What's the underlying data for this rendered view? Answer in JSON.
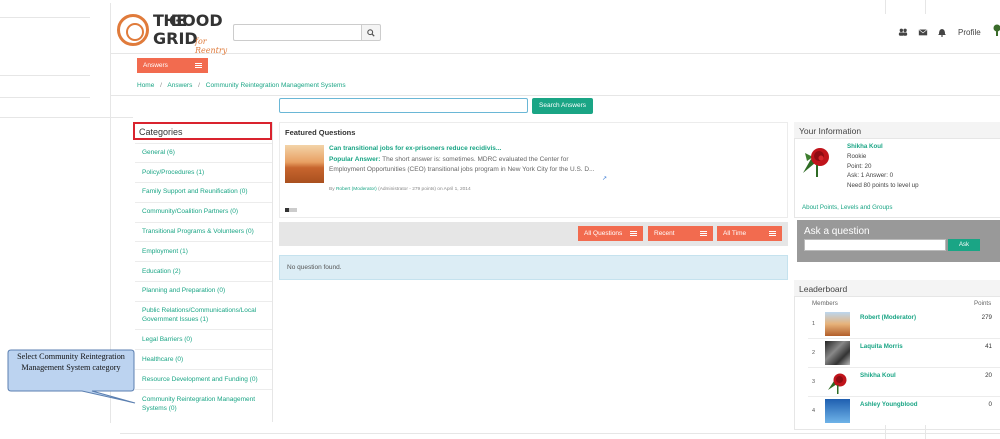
{
  "brand": {
    "line1": "THE",
    "line1b": "GOOD",
    "line2": "GRID",
    "tagline": "for Reentry"
  },
  "header": {
    "profile_label": "Profile"
  },
  "nav": {
    "answers_tab": "Answers"
  },
  "breadcrumb": {
    "home": "Home",
    "sep1": "/",
    "answers": "Answers",
    "sep2": "/",
    "current": "Community Reintegration Management Systems"
  },
  "search": {
    "button_label": "Search Answers"
  },
  "categories": {
    "heading": "Categories",
    "items": [
      "General (6)",
      "Policy/Procedures (1)",
      "Family Support and Reunification (0)",
      "Community/Coalition Partners (0)",
      "Transitional Programs & Volunteers (0)",
      "Employment (1)",
      "Education (2)",
      "Planning and Preparation (0)",
      "Public Relations/Communications/Local Government Issues (1)",
      "Legal Barriers (0)",
      "Healthcare (0)",
      "Resource Development and Funding (0)",
      "Community Reintegration Management Systems (0)"
    ]
  },
  "featured": {
    "heading": "Featured Questions",
    "question": "Can transitional jobs for ex-prisoners reduce recidivis...",
    "popular_label": "Popular Answer:",
    "popular_text": " The short answer is: sometimes. MDRC evaluated the Center for Employment Opportunities (CEO) transitional jobs program in New York City for the U.S. D...",
    "meta_prefix": "By",
    "meta_author": "Robert (Moderator)",
    "meta_rest": "(Administrator - 279 points)  on April 1, 2014"
  },
  "filters": {
    "all_questions": "All Questions",
    "recent": "Recent",
    "all_time": "All Time"
  },
  "empty_message": "No question found.",
  "your_info": {
    "heading": "Your Information",
    "name": "Shikha Koul",
    "rank": "Rookie",
    "points": "Point: 20",
    "ask_answer": "Ask: 1    Answer: 0",
    "next_level": "Need 80 points to level up",
    "about_link": "About Points, Levels and Groups"
  },
  "ask": {
    "heading": "Ask a question",
    "button_label": "Ask"
  },
  "leaderboard": {
    "heading": "Leaderboard",
    "col_members": "Members",
    "col_points": "Points",
    "rows": [
      {
        "rank": "1",
        "name": "Robert (Moderator)",
        "points": "279"
      },
      {
        "rank": "2",
        "name": "Laquita Morris",
        "points": "41"
      },
      {
        "rank": "3",
        "name": "Shikha Koul",
        "points": "20"
      },
      {
        "rank": "4",
        "name": "Ashley Youngblood",
        "points": "0"
      }
    ]
  },
  "callout": {
    "text": "Select Community Reintegration Management System category"
  },
  "colors": {
    "accent_orange": "#f26b4f",
    "teal": "#1aa585",
    "highlight_red": "#d9232e",
    "callout_fill": "#bcd3f0"
  }
}
